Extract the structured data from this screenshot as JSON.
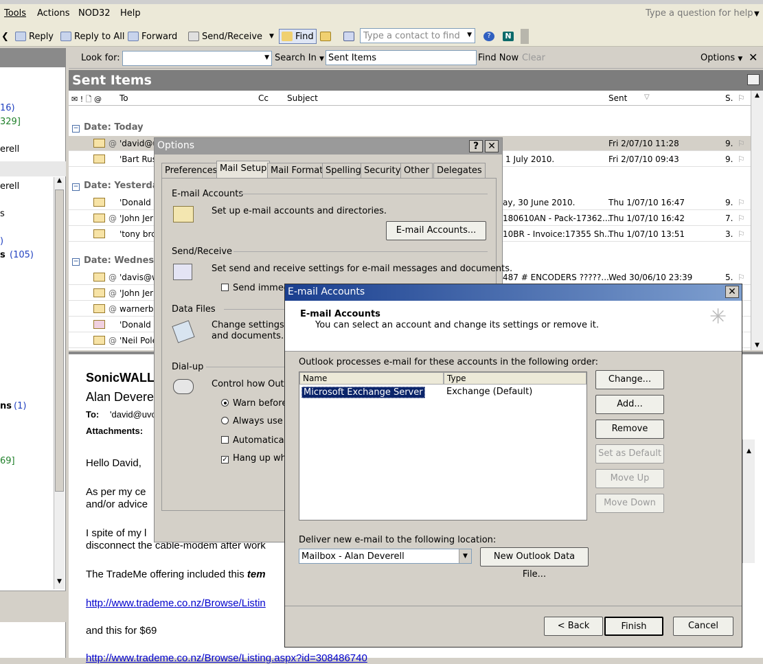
{
  "menu": {
    "tools": "Tools",
    "actions": "Actions",
    "nod32": "NOD32",
    "help": "Help",
    "question_placeholder": "Type a question for help"
  },
  "toolbar": {
    "reply": "Reply",
    "reply_all": "Reply to All",
    "forward": "Forward",
    "send_receive": "Send/Receive",
    "find": "Find",
    "contact_placeholder": "Type a contact to find"
  },
  "sidebar": {
    "items_top": [
      "16)",
      "329]",
      "erell"
    ],
    "items_mid": [
      "erell",
      "s",
      ")",
      "s",
      "(105)"
    ],
    "items_bot": [
      "ns",
      "(1)",
      "69]"
    ]
  },
  "findbar": {
    "look_for": "Look for:",
    "search_in": "Search In",
    "search_in_value": "Sent Items",
    "find_now": "Find Now",
    "clear": "Clear",
    "options": "Options"
  },
  "folder": {
    "title": "Sent Items"
  },
  "columns": {
    "to": "To",
    "cc": "Cc",
    "subject": "Subject",
    "sent": "Sent",
    "size": "S."
  },
  "groups": [
    {
      "label": "Date: Today"
    },
    {
      "label": "Date: Yesterda"
    },
    {
      "label": "Date: Wednesd"
    }
  ],
  "messages": [
    {
      "to": "'david@u",
      "subject": "",
      "sent": "Fri 2/07/10 11:28",
      "size": "9."
    },
    {
      "to": "'Bart Rus",
      "subject": "1 July 2010.",
      "sent": "Fri 2/07/10 09:43",
      "size": "9."
    },
    {
      "to": "'Donald F",
      "subject": "ay, 30 June 2010.",
      "sent": "Thu 1/07/10 16:47",
      "size": "9."
    },
    {
      "to": "'John Jer",
      "subject": "180610AN - Pack-17362...",
      "sent": "Thu 1/07/10 16:42",
      "size": "7."
    },
    {
      "to": "'tony brc",
      "subject": "10BR - Invoice:17355 Sh...",
      "sent": "Thu 1/07/10 13:51",
      "size": "3."
    },
    {
      "to": "'davis@w",
      "subject": "487 # ENCODERS ?????...",
      "sent": "Wed 30/06/10 23:39",
      "size": "5."
    },
    {
      "to": "'John Jer",
      "subject": "",
      "sent": "",
      "size": ""
    },
    {
      "to": "warnerb",
      "subject": "",
      "sent": "",
      "size": ""
    },
    {
      "to": "'Donald F",
      "subject": "",
      "sent": "",
      "size": ""
    },
    {
      "to": "'Neil Pole",
      "subject": "",
      "sent": "",
      "size": ""
    }
  ],
  "reading": {
    "from_line": "SonicWALL",
    "name_line": "Alan Devere",
    "to_label": "To:",
    "to_value": "'david@uvc",
    "attach_label": "Attachments:",
    "greeting": "Hello David,",
    "p1a": "As per my ce",
    "p1b": "and/or advice",
    "p2a": "I spite of my l",
    "p2b": "disconnect the cable-modem after work",
    "p3": "The TradeMe offering included this",
    "p3b": "tem",
    "link1": "http://www.trademe.co.nz/Browse/Listin",
    "p4": "and this for $69",
    "link2": "http://www.trademe.co.nz/Browse/Listing.aspx?id=308486740"
  },
  "options_dialog": {
    "title": "Options",
    "tabs": [
      "Preferences",
      "Mail Setup",
      "Mail Format",
      "Spelling",
      "Security",
      "Other",
      "Delegates"
    ],
    "email_accounts_section": "E-mail Accounts",
    "email_accounts_desc": "Set up e-mail accounts and directories.",
    "email_accounts_button": "E-mail Accounts...",
    "send_receive_section": "Send/Receive",
    "send_receive_desc": "Set send and receive settings for e-mail messages and documents.",
    "send_immediately": "Send immedi",
    "data_files_section": "Data Files",
    "data_files_desc1": "Change settings fo",
    "data_files_desc2": "and documents.",
    "dialup_section": "Dial-up",
    "dialup_desc": "Control how Outloc",
    "warn_before": "Warn before",
    "always_use": "Always use ar",
    "automatically": "Automatically",
    "hang_up": "Hang up wher"
  },
  "email_accounts_dialog": {
    "title": "E-mail Accounts",
    "heading": "E-mail Accounts",
    "subheading": "You can select an account and change its settings or remove it.",
    "order_label": "Outlook processes e-mail for these accounts in the following order:",
    "col_name": "Name",
    "col_type": "Type",
    "accounts": [
      {
        "name": "Microsoft Exchange Server",
        "type": "Exchange (Default)"
      }
    ],
    "buttons": {
      "change": "Change...",
      "add": "Add...",
      "remove": "Remove",
      "set_default": "Set as Default",
      "move_up": "Move Up",
      "move_down": "Move Down"
    },
    "deliver_label": "Deliver new e-mail to the following location:",
    "deliver_value": "Mailbox - Alan Deverell",
    "new_data_file": "New Outlook Data File...",
    "back": "< Back",
    "finish": "Finish",
    "cancel": "Cancel"
  }
}
